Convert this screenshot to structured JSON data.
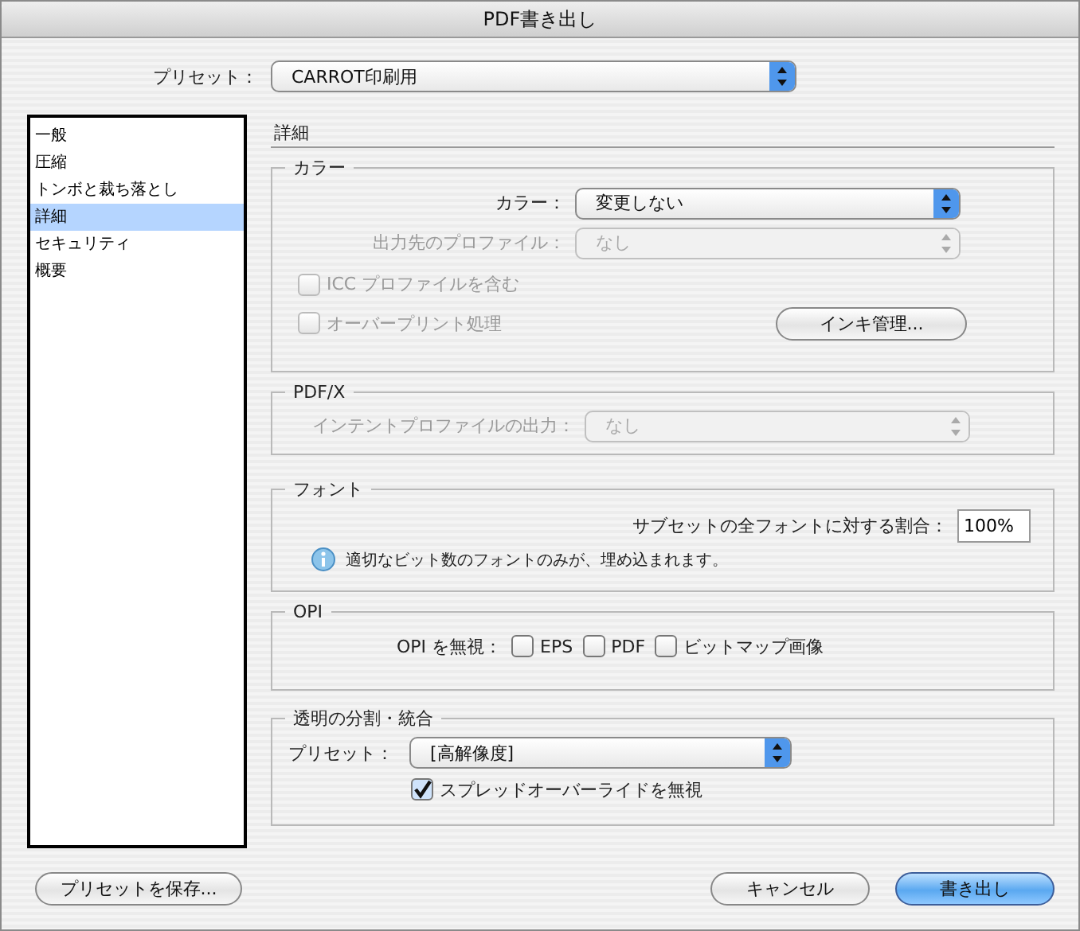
{
  "window": {
    "title": "PDF書き出し"
  },
  "preset": {
    "label": "プリセット：",
    "value": "CARROT印刷用",
    "disabled": false
  },
  "sidebar": {
    "items": [
      {
        "label": "一般",
        "selected": false
      },
      {
        "label": "圧縮",
        "selected": false
      },
      {
        "label": "トンボと裁ち落とし",
        "selected": false
      },
      {
        "label": "詳細",
        "selected": true
      },
      {
        "label": "セキュリティ",
        "selected": false
      },
      {
        "label": "概要",
        "selected": false
      }
    ]
  },
  "section_title": "詳細",
  "color": {
    "title": "カラー",
    "selects": [
      {
        "label": "カラー：",
        "value": "変更しない",
        "disabled": false
      },
      {
        "label": "出力先のプロファイル：",
        "value": "なし",
        "disabled": true
      }
    ],
    "checkboxes": [
      {
        "label": "ICC プロファイルを含む",
        "checked": false,
        "disabled": true
      },
      {
        "label": "オーバープリント処理",
        "checked": false,
        "disabled": true
      }
    ],
    "ink_button": "インキ管理..."
  },
  "pdfx": {
    "title": "PDF/X",
    "select": {
      "label": "インテントプロファイルの出力：",
      "value": "なし",
      "disabled": true
    }
  },
  "fonts": {
    "title": "フォント",
    "field_label": "サブセットの全フォントに対する割合：",
    "field_value": "100%",
    "info": "適切なビット数のフォントのみが、埋め込まれます。"
  },
  "opi": {
    "title": "OPI",
    "label": "OPI を無視：",
    "checkboxes": [
      {
        "label": "EPS",
        "checked": false,
        "disabled": false
      },
      {
        "label": "PDF",
        "checked": false,
        "disabled": false
      },
      {
        "label": "ビットマップ画像",
        "checked": false,
        "disabled": false
      }
    ]
  },
  "flattener": {
    "title": "透明の分割・統合",
    "select": {
      "label": "プリセット：",
      "value": "[高解像度]",
      "disabled": false
    },
    "checkbox": {
      "label": "スプレッドオーバーライドを無視",
      "checked": true,
      "disabled": false
    }
  },
  "buttons": [
    {
      "label": "プリセットを保存...",
      "kind": "secondary"
    },
    {
      "label": "キャンセル",
      "kind": "secondary"
    },
    {
      "label": "書き出し",
      "kind": "default"
    }
  ]
}
